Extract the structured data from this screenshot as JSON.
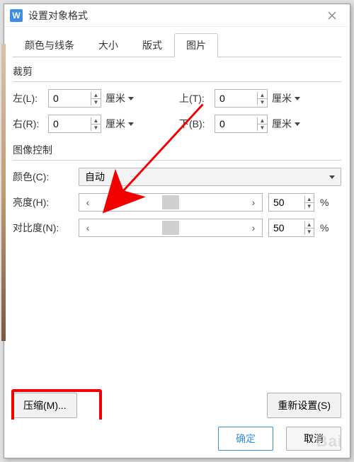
{
  "titlebar": {
    "title": "设置对象格式"
  },
  "tabs": {
    "items": [
      {
        "label": "颜色与线条"
      },
      {
        "label": "大小"
      },
      {
        "label": "版式"
      },
      {
        "label": "图片"
      }
    ]
  },
  "crop": {
    "title": "裁剪",
    "left_label": "左(L):",
    "right_label": "右(R):",
    "top_label": "上(T):",
    "bottom_label": "下(B):",
    "left_value": "0",
    "right_value": "0",
    "top_value": "0",
    "bottom_value": "0",
    "unit": "厘米"
  },
  "imgctrl": {
    "title": "图像控制",
    "color_label": "颜色(C):",
    "color_value": "自动",
    "brightness_label": "亮度(H):",
    "brightness_value": "50",
    "contrast_label": "对比度(N):",
    "contrast_value": "50",
    "percent": "%"
  },
  "buttons": {
    "compress": "压缩(M)...",
    "reset": "重新设置(S)",
    "ok": "确定",
    "cancel": "取消"
  },
  "watermark": "Bai"
}
